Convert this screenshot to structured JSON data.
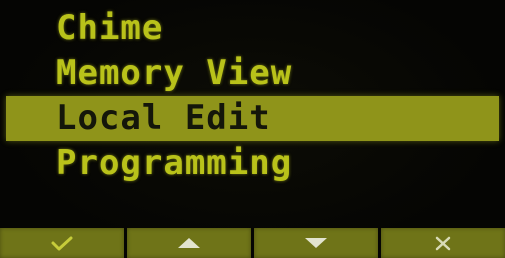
{
  "menu": {
    "items": [
      {
        "label": "Chime",
        "selected": false
      },
      {
        "label": "Memory View",
        "selected": false
      },
      {
        "label": "Local Edit",
        "selected": true
      },
      {
        "label": "Programming",
        "selected": false
      }
    ]
  },
  "softkeys": [
    {
      "icon": "checkmark-icon"
    },
    {
      "icon": "arrow-up-icon"
    },
    {
      "icon": "arrow-down-icon"
    },
    {
      "icon": "cancel-x-icon"
    }
  ],
  "colors": {
    "text": "#b9c21a",
    "highlight": "#8f941a",
    "softkey": "#6f7418",
    "background": "#050503"
  }
}
